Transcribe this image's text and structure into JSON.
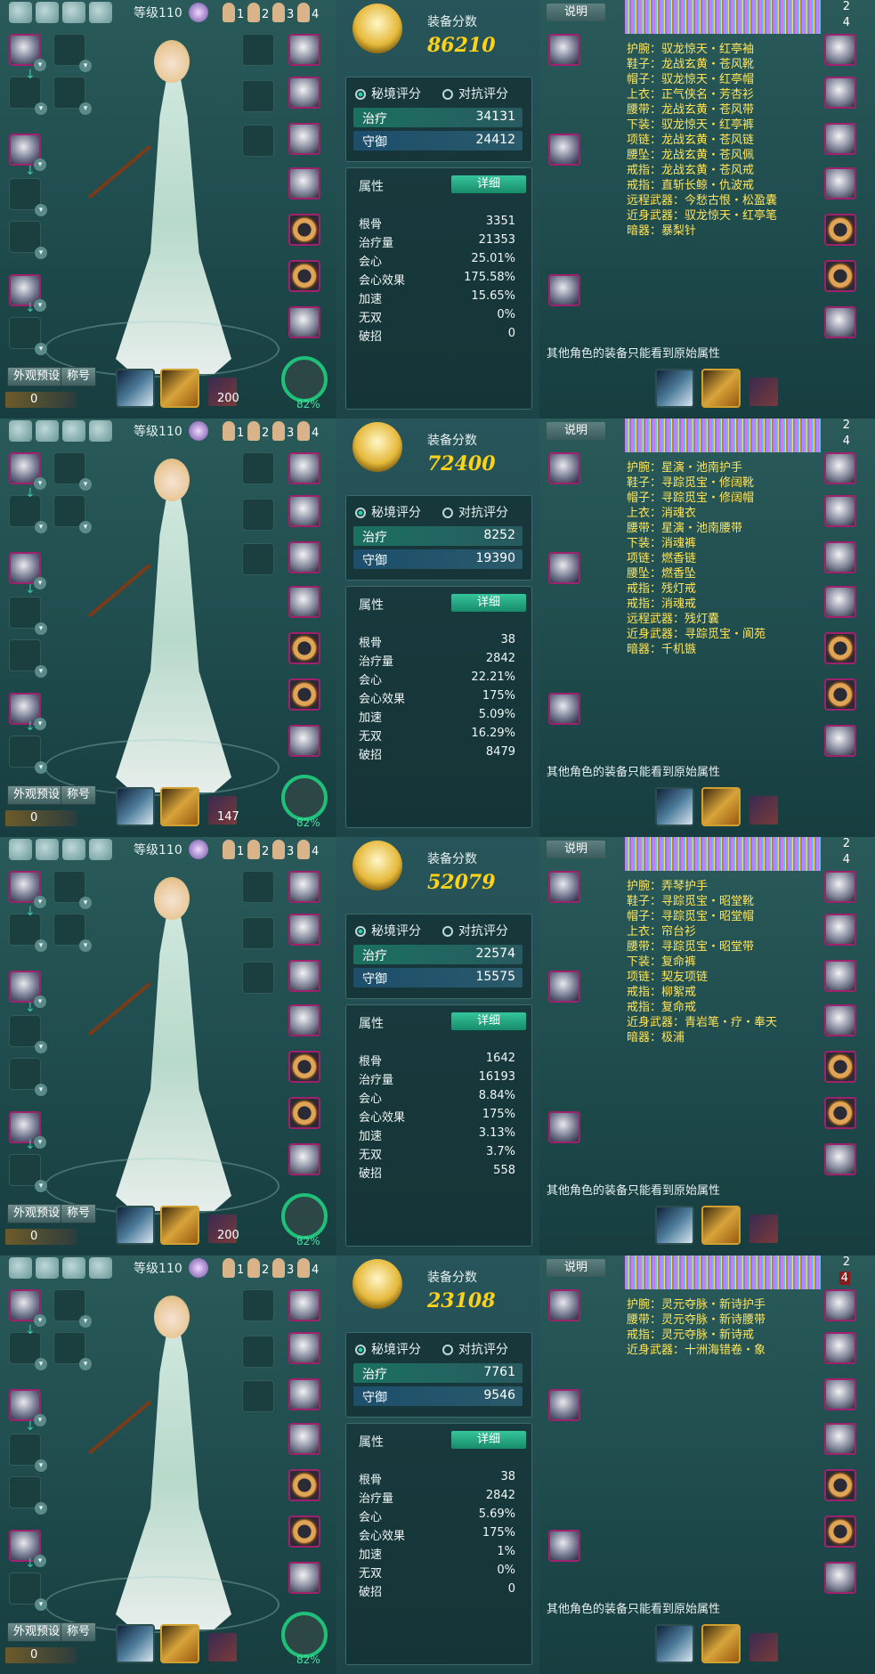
{
  "panels": [
    {
      "level": "等级110",
      "players": [
        "1",
        "2",
        "3",
        "4"
      ],
      "appearance_btn": "外观预设",
      "title_btn": "称号",
      "coin": "0",
      "ammo": "200",
      "progress": "82%",
      "score_title": "装备分数",
      "score": "86210",
      "mode_secret": "秘境评分",
      "mode_pvp": "对抗评分",
      "heal_label": "治疗",
      "heal_value": "34131",
      "def_label": "守御",
      "def_value": "24412",
      "attr_title": "属性",
      "detail_btn": "详细",
      "attrs": [
        {
          "k": "根骨",
          "v": "3351"
        },
        {
          "k": "治疗量",
          "v": "21353"
        },
        {
          "k": "会心",
          "v": "25.01%"
        },
        {
          "k": "会心效果",
          "v": "175.58%"
        },
        {
          "k": "加速",
          "v": "15.65%"
        },
        {
          "k": "无双",
          "v": "0%"
        },
        {
          "k": "破招",
          "v": "0"
        }
      ],
      "explain_btn": "说明",
      "tab_top": "2",
      "tab_bottom": "4",
      "items": [
        "护腕：驭龙惊天・红亭袖",
        "鞋子：龙战玄黄・苍风靴",
        "帽子：驭龙惊天・红亭帽",
        "上衣：正气侠名・芳杏衫",
        "腰带：龙战玄黄・苍风带",
        "下装：驭龙惊天・红亭裤",
        "项链：龙战玄黄・苍风链",
        "腰坠：龙战玄黄・苍风佩",
        "戒指：龙战玄黄・苍风戒",
        "戒指：直斩长鲸・仇波戒",
        "远程武器：今愁古恨・松盈囊",
        "近身武器：驭龙惊天・红亭笔",
        "暗器：暴梨针"
      ],
      "footer": "其他角色的装备只能看到原始属性"
    },
    {
      "level": "等级110",
      "players": [
        "1",
        "2",
        "3",
        "4"
      ],
      "appearance_btn": "外观预设",
      "title_btn": "称号",
      "coin": "0",
      "ammo": "147",
      "progress": "82%",
      "score_title": "装备分数",
      "score": "72400",
      "mode_secret": "秘境评分",
      "mode_pvp": "对抗评分",
      "heal_label": "治疗",
      "heal_value": "8252",
      "def_label": "守御",
      "def_value": "19390",
      "attr_title": "属性",
      "detail_btn": "详细",
      "attrs": [
        {
          "k": "根骨",
          "v": "38"
        },
        {
          "k": "治疗量",
          "v": "2842"
        },
        {
          "k": "会心",
          "v": "22.21%"
        },
        {
          "k": "会心效果",
          "v": "175%"
        },
        {
          "k": "加速",
          "v": "5.09%"
        },
        {
          "k": "无双",
          "v": "16.29%"
        },
        {
          "k": "破招",
          "v": "8479"
        }
      ],
      "explain_btn": "说明",
      "tab_top": "2",
      "tab_bottom": "4",
      "items": [
        "护腕：星演・池南护手",
        "鞋子：寻踪觅宝・修阔靴",
        "帽子：寻踪觅宝・修阔帽",
        "上衣：消魂衣",
        "腰带：星演・池南腰带",
        "下装：消魂裤",
        "项链：燃香链",
        "腰坠：燃香坠",
        "戒指：残灯戒",
        "戒指：消魂戒",
        "远程武器：残灯囊",
        "近身武器：寻踪觅宝・阆苑",
        "暗器：千机镞"
      ],
      "footer": "其他角色的装备只能看到原始属性"
    },
    {
      "level": "等级110",
      "players": [
        "1",
        "2",
        "3",
        "4"
      ],
      "appearance_btn": "外观预设",
      "title_btn": "称号",
      "coin": "0",
      "ammo": "200",
      "progress": "82%",
      "score_title": "装备分数",
      "score": "52079",
      "mode_secret": "秘境评分",
      "mode_pvp": "对抗评分",
      "heal_label": "治疗",
      "heal_value": "22574",
      "def_label": "守御",
      "def_value": "15575",
      "attr_title": "属性",
      "detail_btn": "详细",
      "attrs": [
        {
          "k": "根骨",
          "v": "1642"
        },
        {
          "k": "治疗量",
          "v": "16193"
        },
        {
          "k": "会心",
          "v": "8.84%"
        },
        {
          "k": "会心效果",
          "v": "175%"
        },
        {
          "k": "加速",
          "v": "3.13%"
        },
        {
          "k": "无双",
          "v": "3.7%"
        },
        {
          "k": "破招",
          "v": "558"
        }
      ],
      "explain_btn": "说明",
      "tab_top": "2",
      "tab_bottom": "4",
      "items": [
        "护腕：弄琴护手",
        "鞋子：寻踪觅宝・昭堂靴",
        "帽子：寻踪觅宝・昭堂帽",
        "上衣：帘台衫",
        "腰带：寻踪觅宝・昭堂带",
        "下装：复命裤",
        "项链：契友项链",
        "戒指：柳絮戒",
        "戒指：复命戒",
        "近身武器：青岩笔・疗・奉天",
        "暗器：极浦"
      ],
      "footer": "其他角色的装备只能看到原始属性"
    },
    {
      "level": "等级110",
      "players": [
        "1",
        "2",
        "3",
        "4"
      ],
      "appearance_btn": "外观预设",
      "title_btn": "称号",
      "coin": "0",
      "ammo": "",
      "progress": "82%",
      "score_title": "装备分数",
      "score": "23108",
      "mode_secret": "秘境评分",
      "mode_pvp": "对抗评分",
      "heal_label": "治疗",
      "heal_value": "7761",
      "def_label": "守御",
      "def_value": "9546",
      "attr_title": "属性",
      "detail_btn": "详细",
      "attrs": [
        {
          "k": "根骨",
          "v": "38"
        },
        {
          "k": "治疗量",
          "v": "2842"
        },
        {
          "k": "会心",
          "v": "5.69%"
        },
        {
          "k": "会心效果",
          "v": "175%"
        },
        {
          "k": "加速",
          "v": "1%"
        },
        {
          "k": "无双",
          "v": "0%"
        },
        {
          "k": "破招",
          "v": "0"
        }
      ],
      "explain_btn": "说明",
      "tab_top": "2",
      "tab_bottom": "4",
      "items": [
        "护腕：灵元夺脉・新诗护手",
        "腰带：灵元夺脉・新诗腰带",
        "戒指：灵元夺脉・新诗戒",
        "近身武器：十洲海错卷・象"
      ],
      "footer": "其他角色的装备只能看到原始属性"
    }
  ],
  "colors": {
    "score": "#ffd21a",
    "item_text": "#ffe55a",
    "detail_btn": "#1f9a76",
    "accent": "#21c07a"
  },
  "icons": [
    "helmet-icon",
    "armor-icon",
    "boots-icon",
    "necklace-icon",
    "pendant-icon",
    "ring-icon",
    "weapon-icon",
    "hidden-weapon-icon",
    "emblem-icon",
    "gem-icon",
    "person-icon"
  ]
}
